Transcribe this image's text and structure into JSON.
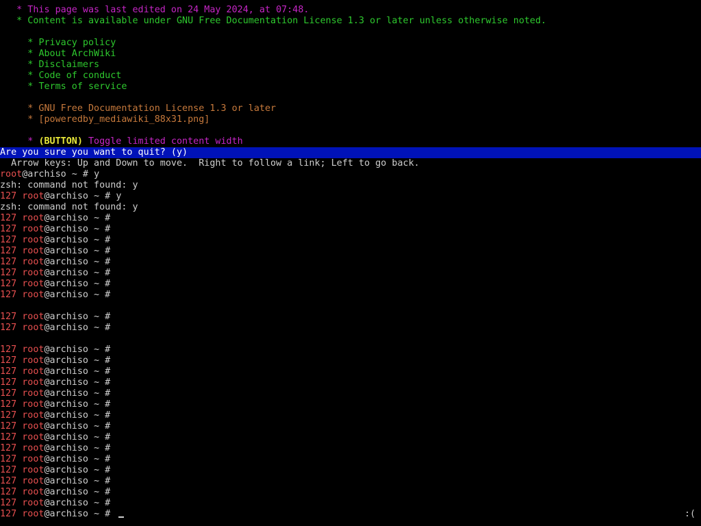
{
  "lynx": {
    "footer": {
      "last_edited": "   * This page was last edited on 24 May 2024, at 07:48.",
      "content_license": "   * Content is available under GNU Free Documentation License 1.3 or later unless otherwise noted."
    },
    "links": [
      {
        "bullet": "     * ",
        "label": "Privacy policy"
      },
      {
        "bullet": "     * ",
        "label": "About ArchWiki"
      },
      {
        "bullet": "     * ",
        "label": "Disclaimers"
      },
      {
        "bullet": "     * ",
        "label": "Code of conduct"
      },
      {
        "bullet": "     * ",
        "label": "Terms of service"
      }
    ],
    "license_links": [
      "     * GNU Free Documentation License 1.3 or later",
      "     * [poweredby_mediawiki_88x31.png]"
    ],
    "toggle": {
      "bullet": "     * ",
      "button_label": "(BUTTON)",
      "text": " Toggle limited content width"
    },
    "quit_prompt": "Are you sure you want to quit? (y)",
    "help_line": "  Arrow keys: Up and Down to move.  Right to follow a link; Left to go back."
  },
  "shell": {
    "lines": [
      {
        "code": "",
        "user": "root",
        "host": "@archiso ~ # ",
        "cmd": "y"
      },
      {
        "output": "zsh: command not found: y"
      },
      {
        "code": "127 ",
        "user": "root",
        "host": "@archiso ~ # ",
        "cmd": "y"
      },
      {
        "output": "zsh: command not found: y"
      },
      {
        "code": "127 ",
        "user": "root",
        "host": "@archiso ~ # ",
        "cmd": ""
      },
      {
        "code": "127 ",
        "user": "root",
        "host": "@archiso ~ # ",
        "cmd": ""
      },
      {
        "code": "127 ",
        "user": "root",
        "host": "@archiso ~ # ",
        "cmd": ""
      },
      {
        "code": "127 ",
        "user": "root",
        "host": "@archiso ~ # ",
        "cmd": ""
      },
      {
        "code": "127 ",
        "user": "root",
        "host": "@archiso ~ # ",
        "cmd": ""
      },
      {
        "code": "127 ",
        "user": "root",
        "host": "@archiso ~ # ",
        "cmd": ""
      },
      {
        "code": "127 ",
        "user": "root",
        "host": "@archiso ~ # ",
        "cmd": ""
      },
      {
        "code": "127 ",
        "user": "root",
        "host": "@archiso ~ # ",
        "cmd": ""
      },
      {
        "blank": true
      },
      {
        "code": "127 ",
        "user": "root",
        "host": "@archiso ~ # ",
        "cmd": ""
      },
      {
        "code": "127 ",
        "user": "root",
        "host": "@archiso ~ # ",
        "cmd": ""
      },
      {
        "blank": true
      },
      {
        "code": "127 ",
        "user": "root",
        "host": "@archiso ~ # ",
        "cmd": ""
      },
      {
        "code": "127 ",
        "user": "root",
        "host": "@archiso ~ # ",
        "cmd": ""
      },
      {
        "code": "127 ",
        "user": "root",
        "host": "@archiso ~ # ",
        "cmd": ""
      },
      {
        "code": "127 ",
        "user": "root",
        "host": "@archiso ~ # ",
        "cmd": ""
      },
      {
        "code": "127 ",
        "user": "root",
        "host": "@archiso ~ # ",
        "cmd": ""
      },
      {
        "code": "127 ",
        "user": "root",
        "host": "@archiso ~ # ",
        "cmd": ""
      },
      {
        "code": "127 ",
        "user": "root",
        "host": "@archiso ~ # ",
        "cmd": ""
      },
      {
        "code": "127 ",
        "user": "root",
        "host": "@archiso ~ # ",
        "cmd": ""
      },
      {
        "code": "127 ",
        "user": "root",
        "host": "@archiso ~ # ",
        "cmd": ""
      },
      {
        "code": "127 ",
        "user": "root",
        "host": "@archiso ~ # ",
        "cmd": ""
      },
      {
        "code": "127 ",
        "user": "root",
        "host": "@archiso ~ # ",
        "cmd": ""
      },
      {
        "code": "127 ",
        "user": "root",
        "host": "@archiso ~ # ",
        "cmd": ""
      },
      {
        "code": "127 ",
        "user": "root",
        "host": "@archiso ~ # ",
        "cmd": ""
      },
      {
        "code": "127 ",
        "user": "root",
        "host": "@archiso ~ # ",
        "cmd": ""
      },
      {
        "code": "127 ",
        "user": "root",
        "host": "@archiso ~ # ",
        "cmd": ""
      },
      {
        "code": "127 ",
        "user": "root",
        "host": "@archiso ~ # ",
        "cmd": "",
        "cursor": true,
        "status_right": ":("
      }
    ]
  },
  "colors": {
    "background": "#000000",
    "bar": "#0012b8",
    "prompt_red": "#e85050",
    "magenta": "#c526c5",
    "green": "#2ec92e",
    "orange": "#c87a3c"
  }
}
